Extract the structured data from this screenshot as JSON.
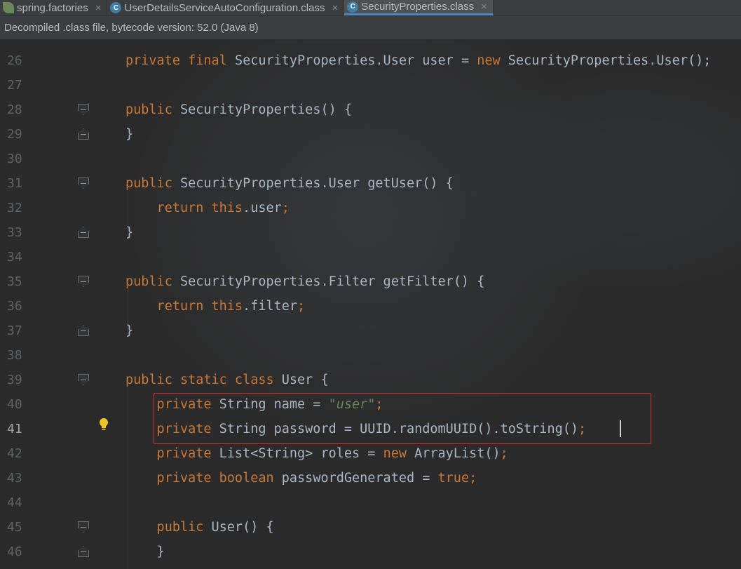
{
  "tabs": [
    {
      "label": "spring.factories",
      "icon": "spring-leaf-icon",
      "active": false
    },
    {
      "label": "UserDetailsServiceAutoConfiguration.class",
      "icon": "class-icon",
      "active": false
    },
    {
      "label": "SecurityProperties.class",
      "icon": "class-icon",
      "active": true
    }
  ],
  "tab_close_glyph": "×",
  "banner": "Decompiled .class file, bytecode version: 52.0 (Java 8)",
  "current_line": 41,
  "lines": [
    {
      "no": "26",
      "tokens": [
        [
          "kw",
          "private final "
        ],
        [
          "pl",
          "SecurityProperties.User user = "
        ],
        [
          "kw",
          "new "
        ],
        [
          "pl",
          "SecurityProperties.User();"
        ]
      ]
    },
    {
      "no": "27",
      "tokens": []
    },
    {
      "no": "28",
      "tokens": [
        [
          "kw",
          "public "
        ],
        [
          "pl",
          "SecurityProperties() {"
        ]
      ]
    },
    {
      "no": "29",
      "tokens": [
        [
          "pl",
          "}"
        ]
      ]
    },
    {
      "no": "30",
      "tokens": []
    },
    {
      "no": "31",
      "tokens": [
        [
          "kw",
          "public "
        ],
        [
          "pl",
          "SecurityProperties.User getUser() {"
        ]
      ]
    },
    {
      "no": "32",
      "tokens": [
        [
          "kw",
          "    return this"
        ],
        [
          "pl",
          "."
        ],
        [
          "pl",
          "user"
        ],
        [
          "kw",
          ";"
        ]
      ]
    },
    {
      "no": "33",
      "tokens": [
        [
          "pl",
          "}"
        ]
      ]
    },
    {
      "no": "34",
      "tokens": []
    },
    {
      "no": "35",
      "tokens": [
        [
          "kw",
          "public "
        ],
        [
          "pl",
          "SecurityProperties.Filter getFilter() {"
        ]
      ]
    },
    {
      "no": "36",
      "tokens": [
        [
          "kw",
          "    return this"
        ],
        [
          "pl",
          "."
        ],
        [
          "pl",
          "filter"
        ],
        [
          "kw",
          ";"
        ]
      ]
    },
    {
      "no": "37",
      "tokens": [
        [
          "pl",
          "}"
        ]
      ]
    },
    {
      "no": "38",
      "tokens": []
    },
    {
      "no": "39",
      "tokens": [
        [
          "kw",
          "public static class "
        ],
        [
          "pl",
          "User {"
        ]
      ]
    },
    {
      "no": "40",
      "tokens": [
        [
          "kw",
          "    private "
        ],
        [
          "pl",
          "String name = "
        ],
        [
          "str",
          "\"user\""
        ],
        [
          "kw",
          ";"
        ]
      ]
    },
    {
      "no": "41",
      "tokens": [
        [
          "kw",
          "    private "
        ],
        [
          "pl",
          "String password = UUID.randomUUID().toString()"
        ],
        [
          "kw",
          ";"
        ]
      ]
    },
    {
      "no": "42",
      "tokens": [
        [
          "kw",
          "    private "
        ],
        [
          "pl",
          "List<String> roles = "
        ],
        [
          "kw",
          "new "
        ],
        [
          "pl",
          "ArrayList()"
        ],
        [
          "kw",
          ";"
        ]
      ]
    },
    {
      "no": "43",
      "tokens": [
        [
          "kw",
          "    private boolean "
        ],
        [
          "pl",
          "passwordGenerated = "
        ],
        [
          "kw",
          "true;"
        ]
      ]
    },
    {
      "no": "44",
      "tokens": []
    },
    {
      "no": "45",
      "tokens": [
        [
          "kw",
          "    public "
        ],
        [
          "pl",
          "User() {"
        ]
      ]
    },
    {
      "no": "46",
      "tokens": [
        [
          "pl",
          "    }"
        ]
      ]
    }
  ],
  "folds": [
    {
      "line": "28",
      "type": "open"
    },
    {
      "line": "29",
      "type": "close"
    },
    {
      "line": "31",
      "type": "open"
    },
    {
      "line": "33",
      "type": "close"
    },
    {
      "line": "35",
      "type": "open"
    },
    {
      "line": "37",
      "type": "close"
    },
    {
      "line": "39",
      "type": "open"
    },
    {
      "line": "45",
      "type": "open"
    },
    {
      "line": "46",
      "type": "close"
    }
  ],
  "colors": {
    "keyword": "#cc7832",
    "string": "#6a8759",
    "plain": "#a9b7c6",
    "highlight_box": "#e0292b"
  }
}
